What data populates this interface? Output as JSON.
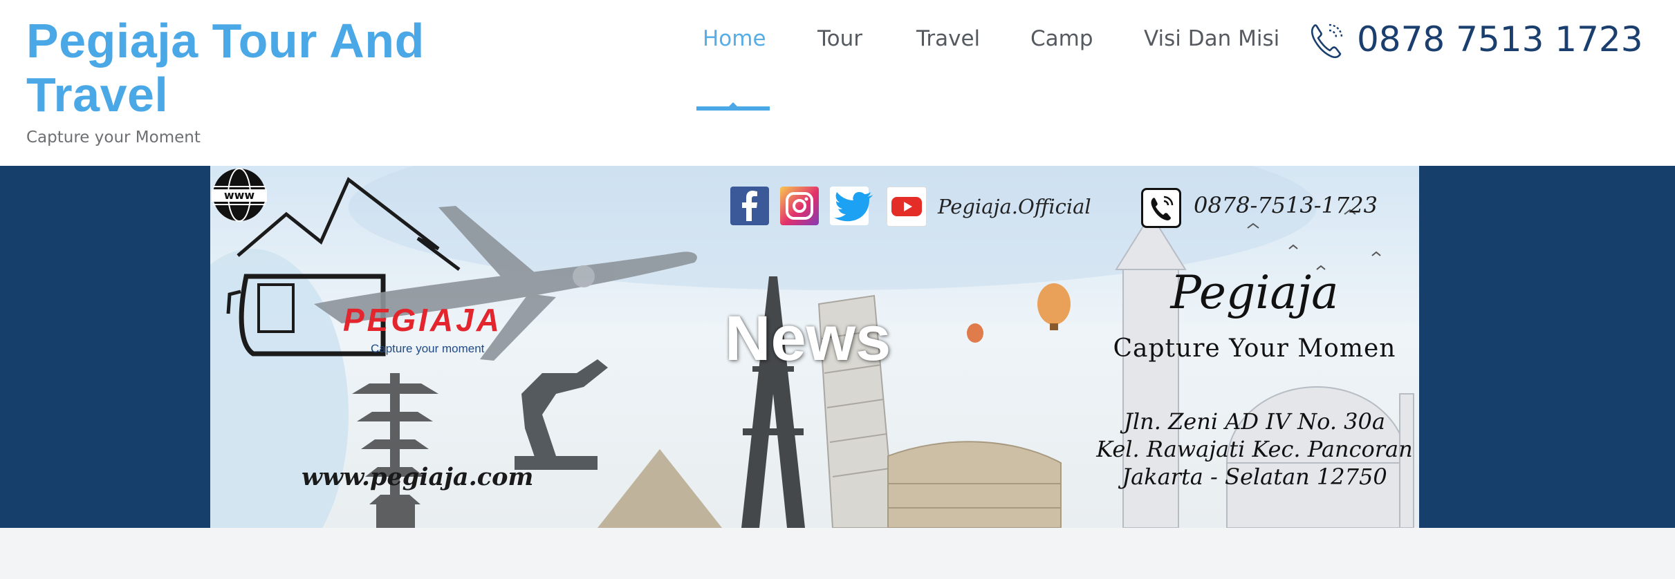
{
  "site": {
    "title": "Pegiaja Tour And Travel",
    "tagline": "Capture your Moment",
    "accent_color": "#4aa8e6",
    "dark_color": "#173f6b"
  },
  "nav": {
    "items": [
      {
        "label": "Home",
        "active": true
      },
      {
        "label": "Tour",
        "active": false
      },
      {
        "label": "Travel",
        "active": false
      },
      {
        "label": "Camp",
        "active": false
      },
      {
        "label": "Visi Dan Misi",
        "active": false
      }
    ],
    "phone_icon": "phone-icon",
    "phone": "0878 7513 1723"
  },
  "banner": {
    "social_icons": [
      "facebook-icon",
      "instagram-icon",
      "twitter-icon",
      "youtube-icon"
    ],
    "official": "Pegiaja.Official",
    "phone": "0878-7513-1723",
    "logo_text": "PEGIAJA",
    "logo_tagline": "Capture your moment",
    "brand": "Pegiaja",
    "slogan": "Capture Your Momen",
    "address": [
      "Jln. Zeni AD IV No. 30a",
      "Kel. Rawajati Kec. Pancoran",
      "Jakarta - Selatan 12750"
    ],
    "website": "www.pegiaja.com",
    "overlay_title": "News"
  }
}
